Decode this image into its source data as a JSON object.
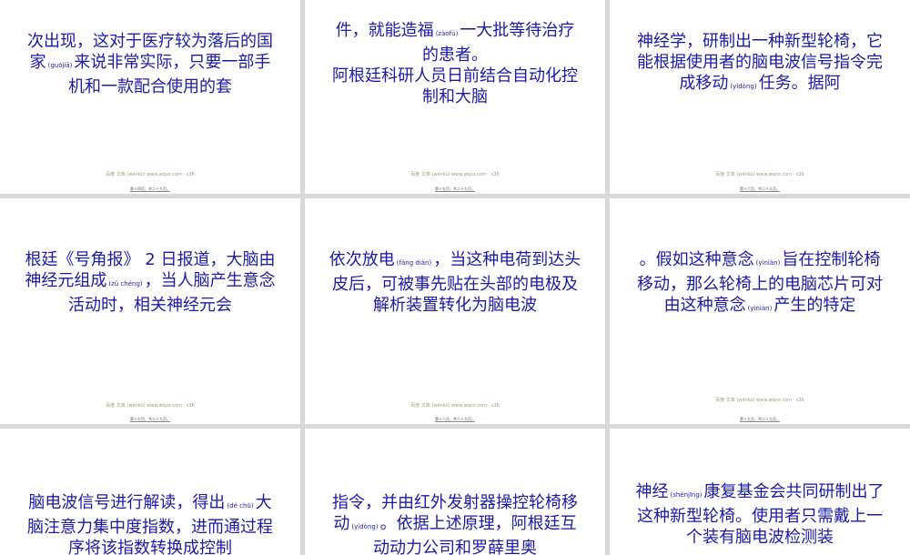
{
  "slides": [
    {
      "id": 1,
      "runs": [
        {
          "t": "次出现，这对于医疗较为落后的国家"
        },
        {
          "r": "(guójiā)"
        },
        {
          "t": "来说非常实际，只要一部手机和一款配合使用的套"
        }
      ],
      "watermark": "百度 文库 (wénkù) www.wqxx.com · s36",
      "page": "第十四页，共二十九页。"
    },
    {
      "id": 2,
      "runs": [
        {
          "t": "件，就能造福"
        },
        {
          "r": "(zàofú)"
        },
        {
          "t": "一大批等待治疗的患者。"
        }
      ],
      "runs2": [
        {
          "t": "阿根廷科研人员日前结合自动化控制和大脑"
        }
      ],
      "watermark": "百度 文库 (wénkù) www.wqxx.com · s36",
      "page": "第十五页，共二十九页。"
    },
    {
      "id": 3,
      "runs": [
        {
          "t": "神经学，研制出一种新型轮椅，它能根据使用者的脑电波信号指令完成移动"
        },
        {
          "r": "(yídòng)"
        },
        {
          "t": "任务。据阿"
        }
      ],
      "watermark": "百度 文库 (wénkù) www.wqxx.com · s36",
      "page": "第十六页，共二十九页。"
    },
    {
      "id": 4,
      "runs": [
        {
          "t": "根廷《号角报》 2 日报道，大脑由神经元组成"
        },
        {
          "r": "(zǔ chéng)"
        },
        {
          "t": "，当人脑产生意念活动时，相关神经元会"
        }
      ],
      "watermark": "百度 文库 (wénkù) www.wqxx.com · s36",
      "page": "第十七页，共二十九页。"
    },
    {
      "id": 5,
      "runs": [
        {
          "t": "依次放电"
        },
        {
          "r": "(fàng diàn)"
        },
        {
          "t": "，当这种电荷到达头皮后，可被事先贴在头部的电极及解析装置转化为脑电波"
        }
      ],
      "watermark": "百度 文库 (wénkù) www.wqxx.com · s36",
      "page": "第十八页，共二十九页。"
    },
    {
      "id": 6,
      "runs": [
        {
          "t": "。假如这种意念"
        },
        {
          "r": "(yìniàn)"
        },
        {
          "t": "旨在控制轮椅移动，那么轮椅上的电脑芯片可对由这种意念"
        },
        {
          "r": "(yìniàn)"
        },
        {
          "t": "产生的特定"
        }
      ],
      "watermark": "百度 文库 (wénkù) www.wqxx.com · s36",
      "page": "第十九页，共二十九页。"
    },
    {
      "id": 7,
      "runs": [
        {
          "t": "脑电波信号进行解读，得出"
        },
        {
          "r": "(dé chū)"
        },
        {
          "t": "大脑注意力集中度指数，进而通过程序将该指数转换成控制"
        }
      ]
    },
    {
      "id": 8,
      "runs": [
        {
          "t": "指令，并由红外发射器操控轮椅移动"
        },
        {
          "r": "(yídòng)"
        },
        {
          "t": "。依据上述原理，阿根廷互动动力公司和罗薛里奥"
        }
      ]
    },
    {
      "id": 9,
      "runs": [
        {
          "t": "神经"
        },
        {
          "r": "(shénjīng)"
        },
        {
          "t": "康复基金会共同研制出了这种新型轮椅。使用者只需戴上一个装有脑电波检测装"
        }
      ]
    }
  ]
}
